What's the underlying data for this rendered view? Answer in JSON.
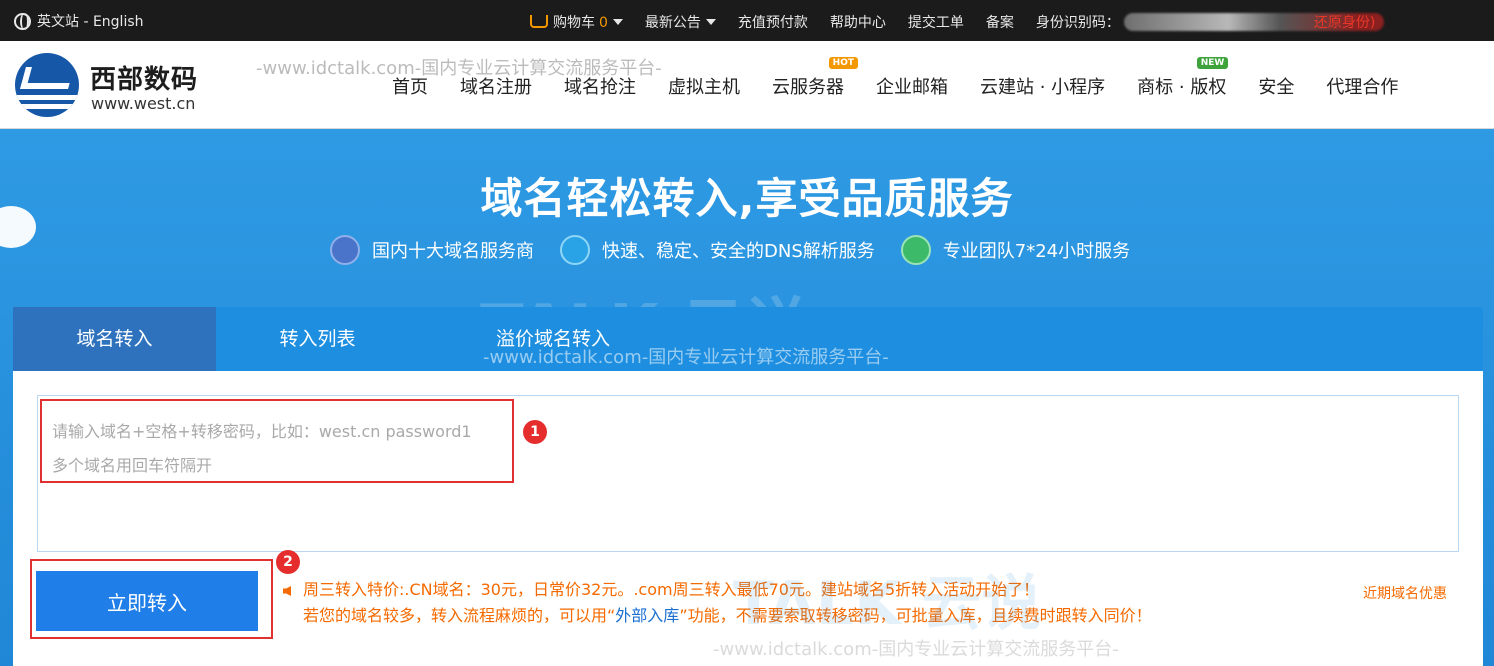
{
  "topbar": {
    "language": "英文站 - English",
    "cart": "购物车",
    "cart_count": "0",
    "announcements": "最新公告",
    "recharge": "充值预付款",
    "help": "帮助中心",
    "ticket": "提交工单",
    "icp": "备案",
    "id_label": "身份识别码：",
    "restore": "还原身份)"
  },
  "header": {
    "brand_name": "西部数码",
    "brand_url": "www.west.cn",
    "nav": [
      "首页",
      "域名注册",
      "域名抢注",
      "虚拟主机",
      "云服务器",
      "企业邮箱",
      "云建站 · 小程序",
      "商标 · 版权",
      "安全",
      "代理合作"
    ],
    "badge_hot": "HOT",
    "badge_new": "NEW"
  },
  "hero": {
    "title": "域名轻松转入,享受品质服务",
    "features": [
      "国内十大域名服务商",
      "快速、稳定、安全的DNS解析服务",
      "专业团队7*24小时服务"
    ]
  },
  "tabs": [
    "域名转入",
    "转入列表",
    "溢价域名转入"
  ],
  "form": {
    "placeholder_line1": "请输入域名+空格+转移密码，比如：west.cn  password1",
    "placeholder_line2": "多个域名用回车符隔开",
    "submit": "立即转入",
    "marker1": "1",
    "marker2": "2"
  },
  "promo": {
    "line1_a": "周三转入特价:.CN域名：30元，日常价32元。.com周三转入最低70元。建站域名5折转入活动开始了！",
    "line2_a": "若您的域名较多，转入流程麻烦的，可以用“",
    "line2_link": "外部入库",
    "line2_b": "”功能，不需要索取转移密码，可批量入库，且续费时跟转入同价！",
    "recent": "近期域名优惠"
  },
  "watermark": {
    "text1": "-www.idctalk.com-国内专业云计算交流服务平台-",
    "text2": "-www.idctalk.com-国内专业云计算交流服务平台-",
    "text3": "-www.idctalk.com-国内专业云计算交流服务平台-",
    "logo1": "TALK 云说",
    "logo2": "TALK 云说"
  }
}
